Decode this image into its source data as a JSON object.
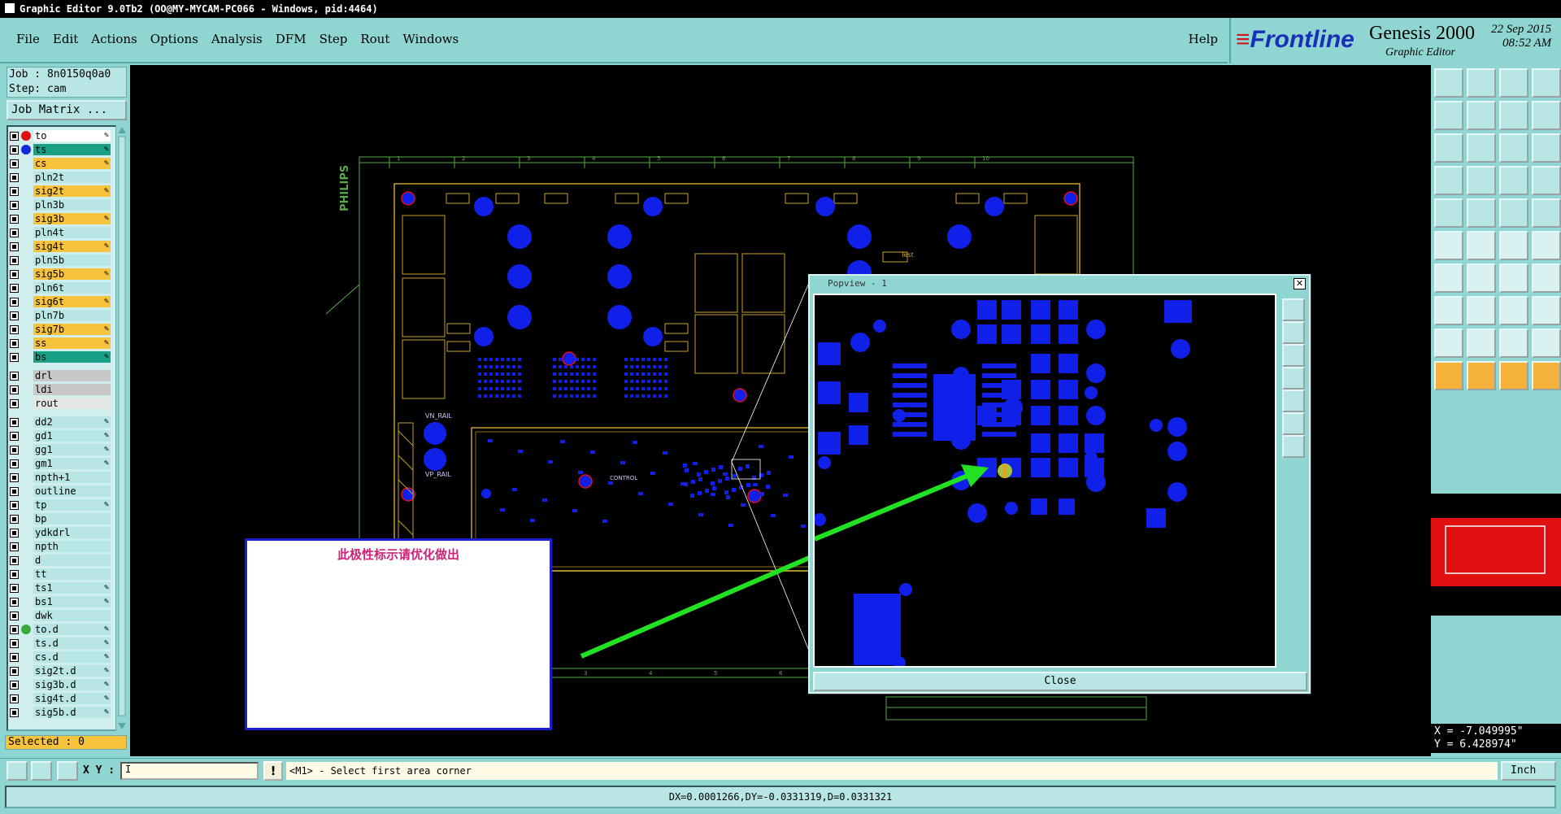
{
  "window": {
    "title": "Graphic Editor 9.0Tb2 (OO@MY-MYCAM-PC066 - Windows, pid:4464)"
  },
  "menu": {
    "items": [
      "File",
      "Edit",
      "Actions",
      "Options",
      "Analysis",
      "DFM",
      "Step",
      "Rout",
      "Windows"
    ],
    "help": "Help"
  },
  "brand": {
    "logo": "Frontline",
    "product": "Genesis 2000",
    "subtitle": "Graphic Editor",
    "date": "22 Sep 2015",
    "time": "08:52 AM"
  },
  "job": {
    "job_line": "Job : 8n0150q0a0",
    "step_line": "Step: cam",
    "matrix_button": "Job Matrix ..."
  },
  "layers": [
    {
      "name": "to",
      "bg": "#ffffff",
      "dot": "#e01010",
      "pen": true
    },
    {
      "name": "ts",
      "bg": "#1aa087",
      "dot": "#1028e0",
      "pen": true
    },
    {
      "name": "cs",
      "bg": "#f7c23c",
      "dot": "",
      "pen": true
    },
    {
      "name": "pln2t",
      "bg": "#b7e6e4",
      "dot": "",
      "pen": false
    },
    {
      "name": "sig2t",
      "bg": "#f7c23c",
      "dot": "",
      "pen": true
    },
    {
      "name": "pln3b",
      "bg": "#b7e6e4",
      "dot": "",
      "pen": false
    },
    {
      "name": "sig3b",
      "bg": "#f7c23c",
      "dot": "",
      "pen": true
    },
    {
      "name": "pln4t",
      "bg": "#b7e6e4",
      "dot": "",
      "pen": false
    },
    {
      "name": "sig4t",
      "bg": "#f7c23c",
      "dot": "",
      "pen": true
    },
    {
      "name": "pln5b",
      "bg": "#b7e6e4",
      "dot": "",
      "pen": false
    },
    {
      "name": "sig5b",
      "bg": "#f7c23c",
      "dot": "",
      "pen": true
    },
    {
      "name": "pln6t",
      "bg": "#b7e6e4",
      "dot": "",
      "pen": false
    },
    {
      "name": "sig6t",
      "bg": "#f7c23c",
      "dot": "",
      "pen": true
    },
    {
      "name": "pln7b",
      "bg": "#b7e6e4",
      "dot": "",
      "pen": false
    },
    {
      "name": "sig7b",
      "bg": "#f7c23c",
      "dot": "",
      "pen": true
    },
    {
      "name": "ss",
      "bg": "#f7c23c",
      "dot": "",
      "pen": true
    },
    {
      "name": "bs",
      "bg": "#1aa087",
      "dot": "",
      "pen": true
    },
    {
      "name": "drl",
      "bg": "#c8c8c8",
      "dot": "",
      "pen": false
    },
    {
      "name": "ldi",
      "bg": "#c8c8c8",
      "dot": "",
      "pen": false
    },
    {
      "name": "rout",
      "bg": "#e6e6e6",
      "dot": "",
      "pen": false
    },
    {
      "name": "dd2",
      "bg": "#b7e6e4",
      "dot": "",
      "pen": true
    },
    {
      "name": "gd1",
      "bg": "#b7e6e4",
      "dot": "",
      "pen": true
    },
    {
      "name": "gg1",
      "bg": "#b7e6e4",
      "dot": "",
      "pen": true
    },
    {
      "name": "gm1",
      "bg": "#b7e6e4",
      "dot": "",
      "pen": true
    },
    {
      "name": "npth+1",
      "bg": "#b7e6e4",
      "dot": "",
      "pen": false
    },
    {
      "name": "outline",
      "bg": "#b7e6e4",
      "dot": "",
      "pen": false
    },
    {
      "name": "tp",
      "bg": "#b7e6e4",
      "dot": "",
      "pen": true
    },
    {
      "name": "bp",
      "bg": "#b7e6e4",
      "dot": "",
      "pen": false
    },
    {
      "name": "ydkdrl",
      "bg": "#b7e6e4",
      "dot": "",
      "pen": false
    },
    {
      "name": "npth",
      "bg": "#b7e6e4",
      "dot": "",
      "pen": false
    },
    {
      "name": "d",
      "bg": "#b7e6e4",
      "dot": "",
      "pen": false
    },
    {
      "name": "tt",
      "bg": "#b7e6e4",
      "dot": "",
      "pen": false
    },
    {
      "name": "ts1",
      "bg": "#b7e6e4",
      "dot": "",
      "pen": true
    },
    {
      "name": "bs1",
      "bg": "#b7e6e4",
      "dot": "",
      "pen": true
    },
    {
      "name": "dwk",
      "bg": "#b7e6e4",
      "dot": "",
      "pen": false
    },
    {
      "name": "to.d",
      "bg": "#b7e6e4",
      "dot": "#3aa83a",
      "pen": true
    },
    {
      "name": "ts.d",
      "bg": "#b7e6e4",
      "dot": "",
      "pen": true
    },
    {
      "name": "cs.d",
      "bg": "#b7e6e4",
      "dot": "",
      "pen": true
    },
    {
      "name": "sig2t.d",
      "bg": "#b7e6e4",
      "dot": "",
      "pen": true
    },
    {
      "name": "sig3b.d",
      "bg": "#b7e6e4",
      "dot": "",
      "pen": true
    },
    {
      "name": "sig4t.d",
      "bg": "#b7e6e4",
      "dot": "",
      "pen": true
    },
    {
      "name": "sig5b.d",
      "bg": "#b7e6e4",
      "dot": "",
      "pen": true
    }
  ],
  "selected": "Selected : 0",
  "board": {
    "brand_mark": "PHILIPS",
    "rail_labels": [
      "VN_RAIL",
      "VP_RAIL"
    ],
    "test_label": "Test",
    "control_label": "CONTROL",
    "ruler_numbers_top": [
      "1",
      "2",
      "3",
      "4",
      "5",
      "6",
      "7",
      "8",
      "9",
      "10"
    ],
    "ruler_numbers_bottom": [
      "1",
      "2",
      "3",
      "4",
      "5",
      "6",
      "7"
    ]
  },
  "popview": {
    "title": "Popview - 1",
    "close_label": "Close"
  },
  "note": {
    "text": "此极性标示请优化做出"
  },
  "coords": {
    "x": "X = -7.049995\"",
    "y": "Y =  6.428974\""
  },
  "bottom": {
    "xy_label": "X Y :",
    "xy_value": "I",
    "excl": "!",
    "message": "<M1> - Select first area corner",
    "units": "Inch",
    "status": "DX=0.0001266,DY=-0.0331319,D=0.0331321"
  },
  "colors": {
    "pad_blue": "#1020e8",
    "outline_yellow": "#c8a028",
    "frame_green": "#5aa84a",
    "arrow_green": "#22e022",
    "note_border": "#1c1cd0"
  }
}
